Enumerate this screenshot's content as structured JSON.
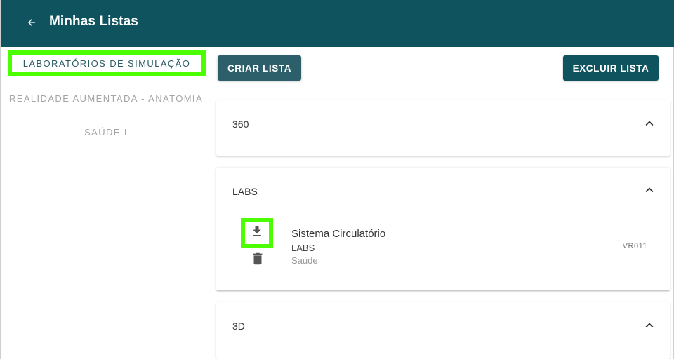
{
  "header": {
    "title": "Minhas Listas",
    "back_icon": "arrow-left-icon",
    "color": "#0e535e"
  },
  "tabs": [
    {
      "label": "LABORATÓRIOS DE SIMULAÇÃO",
      "active": true
    },
    {
      "label": "REALIDADE AUMENTADA - ANATOMIA",
      "active": false
    },
    {
      "label": "SAÚDE I",
      "active": false
    }
  ],
  "toolbar": {
    "create_label": "CRIAR LISTA",
    "delete_label": "EXCLUIR LISTA"
  },
  "lists": [
    {
      "title": "360",
      "expanded_icon": "chevron-up-icon"
    },
    {
      "title": "LABS",
      "expanded_icon": "chevron-up-icon",
      "items": [
        {
          "name": "Sistema Circulatório",
          "category": "LABS",
          "area": "Saúde",
          "code": "VR011",
          "actions": [
            "download-icon",
            "trash-icon"
          ]
        }
      ]
    },
    {
      "title": "3D",
      "expanded_icon": "chevron-up-icon"
    }
  ],
  "highlight_color": "#4cff00"
}
